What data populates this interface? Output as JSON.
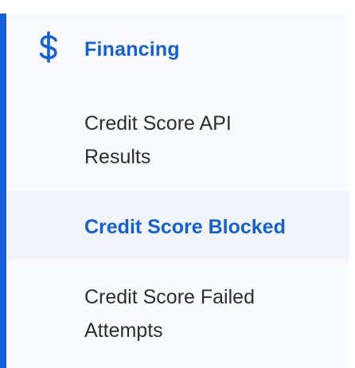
{
  "sidebar": {
    "section": {
      "label": "Financing",
      "icon": "dollar-icon",
      "accent_color": "#1360d8"
    },
    "items": [
      {
        "label_line1": "Credit Score API",
        "label_line2": "Results",
        "active": false
      },
      {
        "label_line1": "Credit Score Blocked",
        "active": true
      },
      {
        "label_line1": "Credit Score Failed",
        "label_line2": "Attempts",
        "active": false
      }
    ]
  }
}
